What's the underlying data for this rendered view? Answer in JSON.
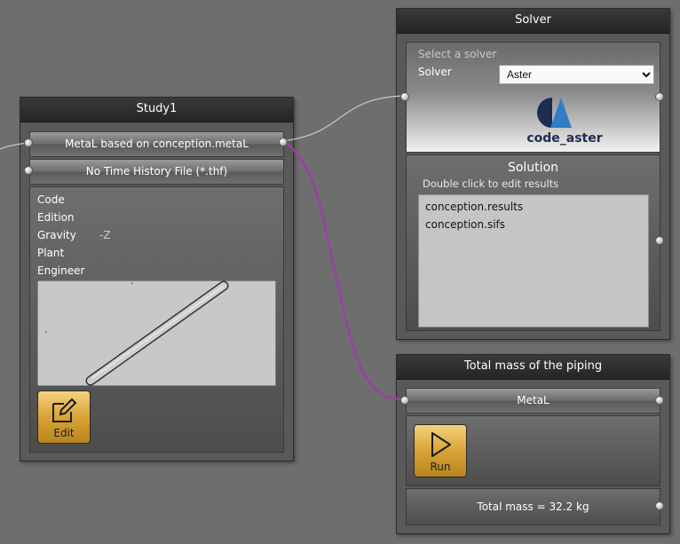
{
  "study": {
    "title": "Study1",
    "port1_label": "MetaL based on conception.metaL",
    "port2_label": "No Time History File (*.thf)",
    "properties": [
      {
        "label": "Code",
        "value": ""
      },
      {
        "label": "Edition",
        "value": ""
      },
      {
        "label": "Gravity",
        "value": "-Z"
      },
      {
        "label": "Plant",
        "value": ""
      },
      {
        "label": "Engineer",
        "value": ""
      }
    ],
    "edit_label": "Edit"
  },
  "solver": {
    "title": "Solver",
    "hint": "Select a solver",
    "field_label": "Solver",
    "selected": "Aster",
    "logo_text": "code_aster",
    "logo_colors": {
      "dark": "#1e2b52",
      "blue": "#2f7dc4"
    }
  },
  "solution": {
    "title": "Solution",
    "hint": "Double click to edit results",
    "files": [
      "conception.results",
      "conception.sifs"
    ]
  },
  "mass": {
    "title": "Total mass of the piping",
    "input_label": "MetaL",
    "run_label": "Run",
    "result": "Total mass = 32.2 kg"
  },
  "wires": {
    "solver_link_color": "#c8c8c8",
    "mass_link_color": "#9b3fa8"
  }
}
